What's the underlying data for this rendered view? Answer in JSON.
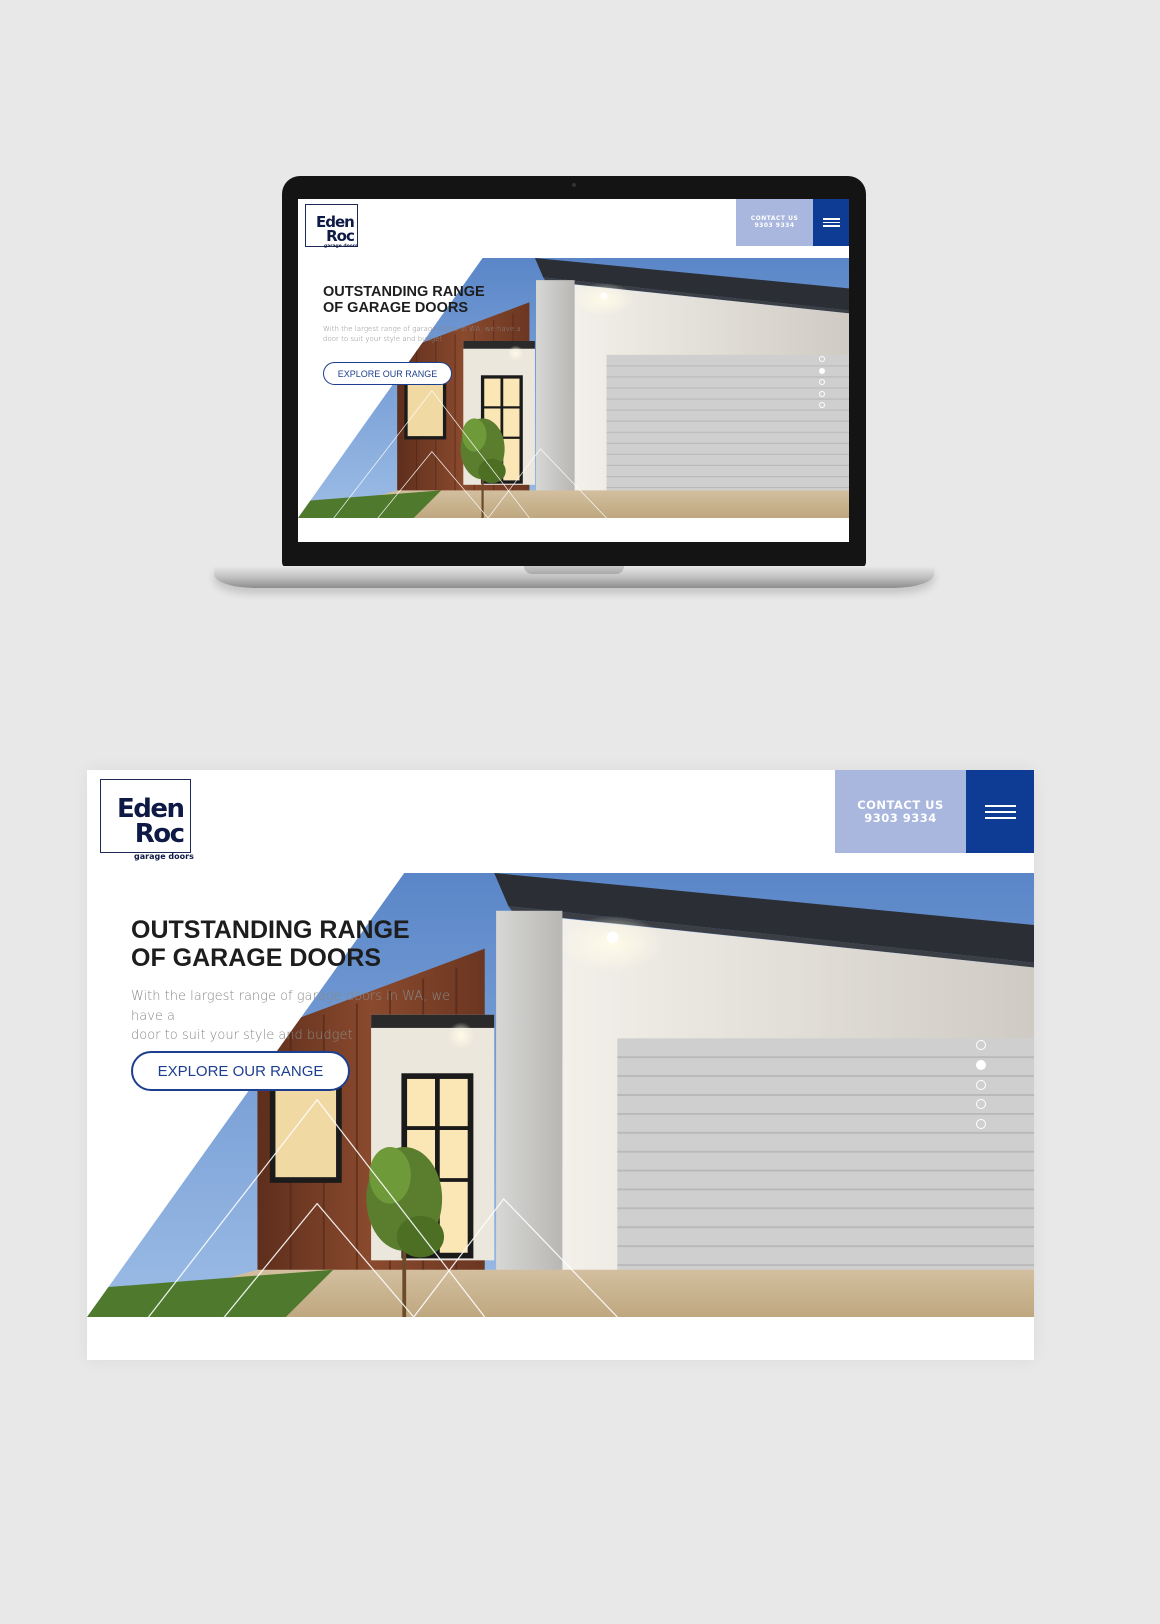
{
  "brand": {
    "logo_line1": "Eden",
    "logo_line2": "Roc",
    "logo_sub": "garage doors"
  },
  "header": {
    "contact_line1": "CONTACT US",
    "contact_line2": "9303 9334"
  },
  "hero": {
    "headline_line1": "OUTSTANDING RANGE",
    "headline_line2": "OF GARAGE DOORS",
    "subtitle_line1": "With the largest range of garage doors in WA, we have a",
    "subtitle_line2": "door to suit your style and budget",
    "cta_label": "EXPLORE OUR RANGE"
  },
  "slider": {
    "count": 5,
    "active_index": 1
  },
  "colors": {
    "background": "#e8e8e8",
    "contact_bg": "#a9b7de",
    "menu_bg": "#0e3b94",
    "brand_navy": "#0e1a45",
    "cta_border": "#1d3f8f"
  }
}
